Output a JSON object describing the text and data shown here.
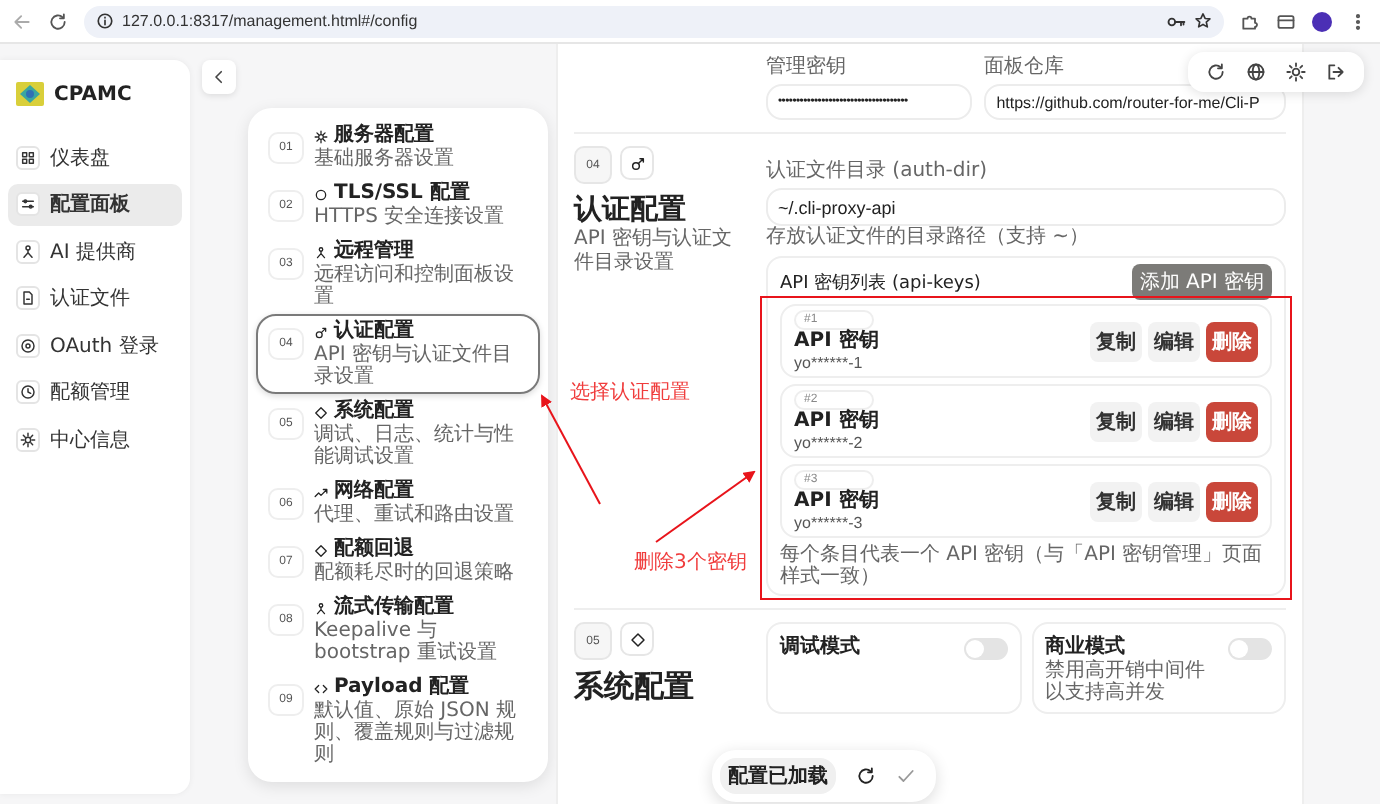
{
  "browser": {
    "url": "127.0.0.1:8317/management.html#/config"
  },
  "sidebar": {
    "logo": "CPAMC",
    "items": [
      {
        "label": "仪表盘",
        "selected": false
      },
      {
        "label": "配置面板",
        "selected": true
      },
      {
        "label": "AI 提供商",
        "selected": false
      },
      {
        "label": "认证文件",
        "selected": false
      },
      {
        "label": "OAuth 登录",
        "selected": false
      },
      {
        "label": "配额管理",
        "selected": false
      },
      {
        "label": "中心信息",
        "selected": false
      }
    ]
  },
  "steps": [
    {
      "number": "01",
      "title": "服务器配置",
      "description": "基础服务器设置",
      "selected": false
    },
    {
      "number": "02",
      "title": "TLS/SSL 配置",
      "description": "HTTPS 安全连接设置",
      "selected": false
    },
    {
      "number": "03",
      "title": "远程管理",
      "description": "远程访问和控制面板设置",
      "selected": false
    },
    {
      "number": "04",
      "title": "认证配置",
      "description": "API 密钥与认证文件目录设置",
      "selected": true
    },
    {
      "number": "05",
      "title": "系统配置",
      "description": "调试、日志、统计与性能调试设置",
      "selected": false
    },
    {
      "number": "06",
      "title": "网络配置",
      "description": "代理、重试和路由设置",
      "selected": false
    },
    {
      "number": "07",
      "title": "配额回退",
      "description": "配额耗尽时的回退策略",
      "selected": false
    },
    {
      "number": "08",
      "title": "流式传输配置",
      "description": "Keepalive 与 bootstrap 重试设置",
      "selected": false
    },
    {
      "number": "09",
      "title": "Payload 配置",
      "description": "默认值、原始 JSON 规则、覆盖规则与过滤规则",
      "selected": false
    }
  ],
  "top_fields": [
    {
      "label": "管理密钥",
      "value": "••••••••••••••••••••••••••••••••••••"
    },
    {
      "label": "面板仓库",
      "value": "https://github.com/router-for-me/Cli-P"
    }
  ],
  "auth_section": {
    "number": "04",
    "title": "认证配置",
    "subtitle": "API 密钥与认证文件目录设置",
    "auth_dir": {
      "label": "认证文件目录 (auth-dir)",
      "value": "~/.cli-proxy-api",
      "hint": "存放认证文件的目录路径（支持 ~）"
    },
    "api_keys": {
      "title": "API 密钥列表 (api-keys)",
      "add_button": "添加 API 密钥",
      "items": [
        {
          "tag": "#1",
          "title": "API 密钥",
          "value": "yo******-1",
          "actions": [
            {
              "label": "复制",
              "kind": "plain"
            },
            {
              "label": "编辑",
              "kind": "plain"
            },
            {
              "label": "删除",
              "kind": "danger"
            }
          ]
        },
        {
          "tag": "#2",
          "title": "API 密钥",
          "value": "yo******-2",
          "actions": [
            {
              "label": "复制",
              "kind": "plain"
            },
            {
              "label": "编辑",
              "kind": "plain"
            },
            {
              "label": "删除",
              "kind": "danger"
            }
          ]
        },
        {
          "tag": "#3",
          "title": "API 密钥",
          "value": "yo******-3",
          "actions": [
            {
              "label": "复制",
              "kind": "plain"
            },
            {
              "label": "编辑",
              "kind": "plain"
            },
            {
              "label": "删除",
              "kind": "danger"
            }
          ]
        }
      ],
      "note": "每个条目代表一个 API 密钥（与「API 密钥管理」页面样式一致）"
    }
  },
  "system_section": {
    "number": "05",
    "title": "系统配置",
    "toggles": [
      {
        "title": "调试模式",
        "on": false
      },
      {
        "title": "商业模式",
        "description": "禁用高开销中间件以支持高并发",
        "on": false
      }
    ]
  },
  "status_bar": {
    "status": "配置已加载"
  },
  "annotations": [
    {
      "text": "选择认证配置"
    },
    {
      "text": "删除3个密钥"
    }
  ]
}
